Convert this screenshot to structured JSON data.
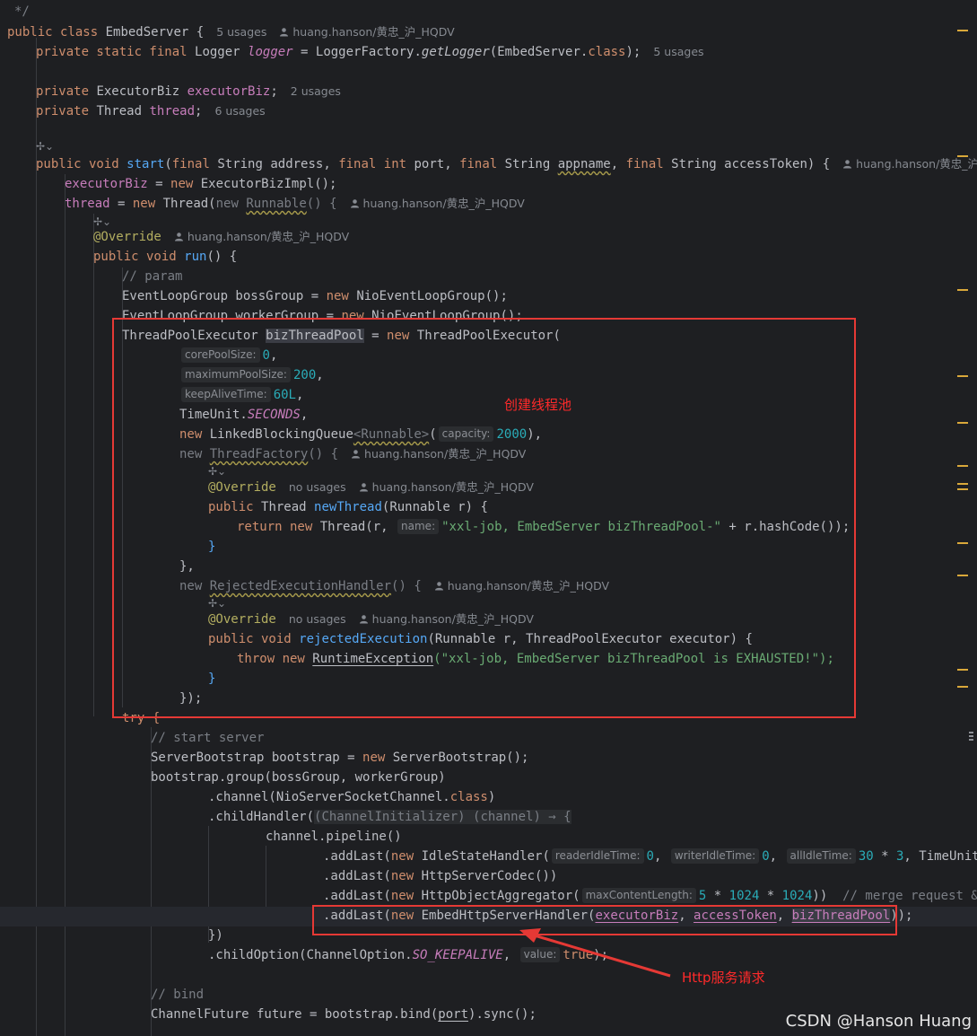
{
  "code": {
    "comment_end": "*/",
    "class_decl": {
      "kw": "public class",
      "name": "EmbedServer",
      "brace": "{",
      "usages": "5 usages",
      "author": "huang.hanson/黄忠_沪_HQDV"
    },
    "logger_line": {
      "mod": "private static final",
      "type": "Logger",
      "name": "logger",
      "eq": " = LoggerFactory.",
      "call": "getLogger",
      "arg": "(EmbedServer.",
      "cls": "class",
      "end": ");",
      "usages": "5 usages"
    },
    "executor_field": {
      "mod": "private",
      "type": "ExecutorBiz",
      "name": "executorBiz",
      "end": ";",
      "usages": "2 usages"
    },
    "thread_field": {
      "mod": "private",
      "type": "Thread",
      "name": "thread",
      "end": ";",
      "usages": "6 usages"
    },
    "start_method": {
      "sig_pre": "public void",
      "name": "start",
      "p1k": "final",
      "p1": "String address, ",
      "p2k": "final int",
      "p2": "port, ",
      "p3k": "final",
      "p3a": "String ",
      "p3b": "appname",
      "p3c": ", ",
      "p4k": "final",
      "p4": "String accessToken) {",
      "author": "huang.hanson/黄忠_沪_HQDV"
    },
    "line_executorBiz": {
      "field": "executorBiz",
      "eq": " = ",
      "kw": "new",
      "rest": "ExecutorBizImpl",
      "end": "();"
    },
    "line_thread": {
      "field": "thread",
      "eq": " = ",
      "kw": "new",
      "type": "Thread(",
      "kw2": "new",
      "runnable": "Runnable",
      "rest": "() {",
      "author": "huang.hanson/黄忠_沪_HQDV"
    },
    "override": "@Override",
    "override_author": "huang.hanson/黄忠_沪_HQDV",
    "run_sig": {
      "kw": "public void",
      "name": "run",
      "rest": "() {"
    },
    "cmt_param": "// param",
    "boss_line": {
      "pre": "EventLoopGroup bossGroup = ",
      "kw": "new",
      "rest": "NioEventLoopGroup();"
    },
    "worker_line": {
      "pre": "EventLoopGroup workerGroup = ",
      "kw": "new",
      "rest": "NioEventLoopGroup();"
    },
    "tpe_line": {
      "pre": "ThreadPoolExecutor ",
      "var": "bizThreadPool",
      "eq": " = ",
      "kw": "new",
      "rest": "ThreadPoolExecutor("
    },
    "hint_core": "corePoolSize:",
    "val_core": "0",
    "hint_max": "maximumPoolSize:",
    "val_max": "200",
    "hint_keep": "keepAliveTime:",
    "val_keep": "60L",
    "timeunit": {
      "pre": "TimeUnit.",
      "val": "SECONDS",
      "end": ","
    },
    "lbq": {
      "kw": "new",
      "name": "LinkedBlockingQueue",
      "gen": "<Runnable>",
      "p": "(",
      "hint": "capacity:",
      "val": "2000",
      "end": "),"
    },
    "tf": {
      "kw": "new",
      "name": "ThreadFactory",
      "rest": "() {",
      "author": "huang.hanson/黄忠_沪_HQDV"
    },
    "no_usages": "no usages",
    "newthread_sig": {
      "kw": "public",
      "type": "Thread",
      "name": "newThread",
      "rest": "(Runnable r) {"
    },
    "return_line": {
      "kw": "return new",
      "pre": "Thread(r, ",
      "hint": "name:",
      "str": "\"xxl-job, EmbedServer bizThreadPool-\"",
      "rest": " + r.hashCode());"
    },
    "close_brace": "}",
    "close_brace_comma": "},",
    "reh": {
      "kw": "new",
      "name": "RejectedExecutionHandler",
      "rest": "() {",
      "author": "huang.hanson/黄忠_沪_HQDV"
    },
    "rejected_sig": {
      "kw": "public void",
      "name": "rejectedExecution",
      "rest": "(Runnable r, ThreadPoolExecutor executor) {"
    },
    "throw_line": {
      "kw": "throw new",
      "name": "RuntimeException",
      "str": "(\"xxl-job, EmbedServer bizThreadPool is EXHAUSTED!\");"
    },
    "close_paren": "});",
    "try_line": "try {",
    "cmt_start": "// start server",
    "bootstrap_line": {
      "pre": "ServerBootstrap bootstrap = ",
      "kw": "new",
      "rest": "ServerBootstrap();"
    },
    "group_line": "bootstrap.group(bossGroup, workerGroup)",
    "channel_line": {
      "pre": ".channel(NioServerSocketChannel.",
      "kw": "class",
      "end": ")"
    },
    "childhandler_line": {
      "pre": ".childHandler(",
      "fold": "(ChannelInitializer) (channel) → {"
    },
    "pipeline_line": "channel.pipeline()",
    "idle_line": {
      "pre": ".addLast(",
      "kw": "new",
      "name": "IdleStateHandler(",
      "h1": "readerIdleTime:",
      "v1": "0",
      "h2": "writerIdleTime:",
      "v2": "0",
      "h3": "allIdleTime:",
      "v3": "30",
      "mid": " * ",
      "v4": "3",
      "rest": ", TimeUnit.SE"
    },
    "codec_line": {
      "pre": ".addLast(",
      "kw": "new",
      "rest": "HttpServerCodec())"
    },
    "agg_line": {
      "pre": ".addLast(",
      "kw": "new",
      "name": "HttpObjectAggregator(",
      "hint": "maxContentLength:",
      "v1": "5",
      "m1": " * ",
      "v2": "1024",
      "m2": " * ",
      "v3": "1024",
      "end": "))",
      "cmt": "// merge request & rep"
    },
    "handler_line": {
      "pre": ".addLast(",
      "kw": "new",
      "name": "EmbedHttpServerHandler(",
      "a1": "executorBiz",
      "c1": ", ",
      "a2": "accessToken",
      "c2": ", ",
      "a3": "bizThreadPool",
      "end": "));"
    },
    "close_fold": "})",
    "childoption_line": {
      "pre": ".childOption(ChannelOption.",
      "val": "SO_KEEPALIVE",
      "c": ", ",
      "hint": "value:",
      "kw": "true",
      "end": ");"
    },
    "cmt_bind": "// bind",
    "bind_line": {
      "pre": "ChannelFuture future = bootstrap.bind(",
      "arg": "port",
      "end": ").sync();"
    }
  },
  "annotations": {
    "create_pool": "创建线程池",
    "http_request": "Http服务请求"
  },
  "watermark": "CSDN @Hanson Huang",
  "colors": {
    "annotation": "#e53935",
    "background": "#1e1f22"
  },
  "icons": {
    "generic": "gen-icon",
    "person": "person-icon"
  }
}
